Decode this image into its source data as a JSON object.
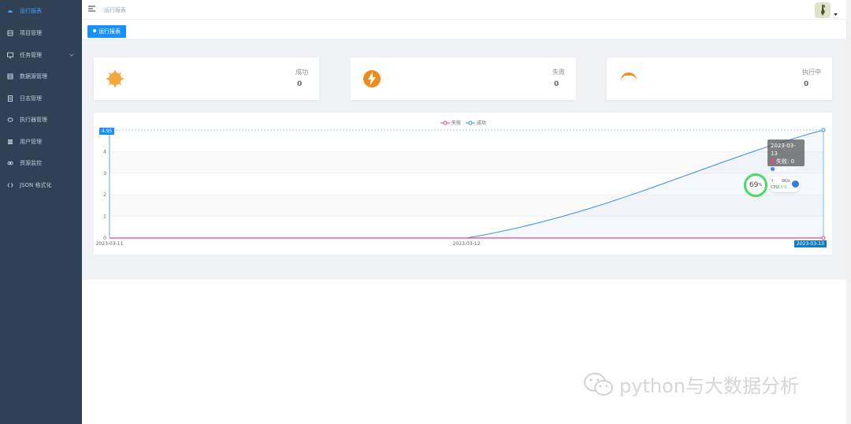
{
  "sidebar": {
    "items": [
      {
        "label": "运行报表",
        "icon": "dashboard-icon",
        "active": true
      },
      {
        "label": "项目管理",
        "icon": "project-icon"
      },
      {
        "label": "任务管理",
        "icon": "monitor-icon",
        "has_submenu": true
      },
      {
        "label": "数据源管理",
        "icon": "database-icon"
      },
      {
        "label": "日志管理",
        "icon": "log-icon"
      },
      {
        "label": "执行器管理",
        "icon": "executor-icon"
      },
      {
        "label": "用户管理",
        "icon": "user-table-icon"
      },
      {
        "label": "资源监控",
        "icon": "link-icon"
      },
      {
        "label": "JSON 格式化",
        "icon": "code-icon"
      }
    ]
  },
  "navbar": {
    "breadcrumb": "运行报表"
  },
  "tags": {
    "active_label": "运行报表"
  },
  "cards": [
    {
      "label": "成功",
      "value": "0",
      "icon": "sun-icon",
      "color": "#f4a73b"
    },
    {
      "label": "失败",
      "value": "0",
      "icon": "lightning-icon",
      "color": "#f08c1e"
    },
    {
      "label": "执行中",
      "value": "0",
      "icon": "moon-icon",
      "color": "#f08c1e"
    }
  ],
  "chart_data": {
    "type": "line",
    "categories": [
      "2023-03-11",
      "2023-03-12",
      "2023-03-13"
    ],
    "series": [
      {
        "name": "失败",
        "values": [
          0,
          0,
          0
        ],
        "color": "#e84393"
      },
      {
        "name": "成功",
        "values": [
          0,
          0,
          5
        ],
        "color": "#3a8ee6"
      }
    ],
    "ylim": [
      0,
      5
    ],
    "yticks": [
      "0",
      "1",
      "2",
      "3",
      "4"
    ],
    "grid": true,
    "legend": "top-center",
    "axis_pointer_y": "4.95",
    "axis_pointer_x": "2023-03-13"
  },
  "tooltip": {
    "title": "2023-03-13",
    "line1": "失败: 0",
    "line2": "成功: 5"
  },
  "cpu_widget": {
    "percent": "69",
    "unit": "%",
    "up": "↑",
    "net": "0K/s",
    "cpu_label": "CPU",
    "temp": "53°C"
  },
  "watermark": {
    "text": "python与大数据分析"
  }
}
